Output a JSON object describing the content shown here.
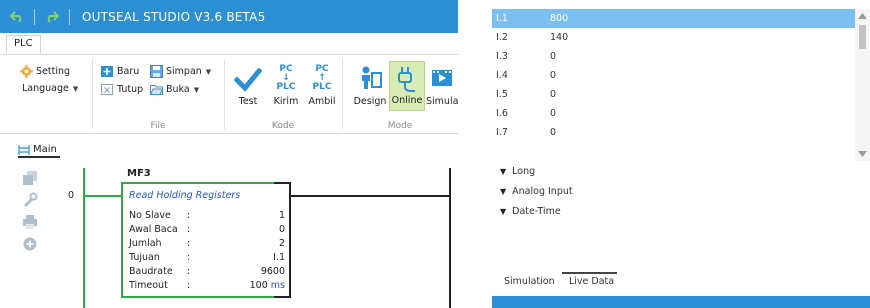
{
  "window": {
    "title": "OUTSEAL STUDIO V3.6 BETA5",
    "undo_icon": "undo-icon",
    "redo_icon": "redo-icon"
  },
  "ribbon": {
    "tab": "PLC",
    "setting_label": "Setting",
    "language_label": "Language",
    "baru_label": "Baru",
    "tutup_label": "Tutup",
    "simpan_label": "Simpan",
    "buka_label": "Buka",
    "file_group_label": "File",
    "test_label": "Test",
    "kirim_label": "Kirim",
    "ambil_label": "Ambil",
    "pc_text": "PC",
    "plc_text": "PLC",
    "kode_group_label": "Kode",
    "design_label": "Design",
    "online_label": "Online",
    "simulation_label": "Simula",
    "mode_group_label": "Mode",
    "colors": {
      "accent": "#2c8fd4",
      "active": "#d8ecb5",
      "check": "#2c8fd4"
    }
  },
  "doc_tab": {
    "label": "Main"
  },
  "ladder": {
    "rung_number": "0",
    "block_title": "MF3",
    "block_name": "Read Holding Registers",
    "params": [
      {
        "key": "No Slave",
        "sep": ":",
        "value": "1",
        "unit": ""
      },
      {
        "key": "Awal Baca",
        "sep": ":",
        "value": "0",
        "unit": ""
      },
      {
        "key": "Jumlah",
        "sep": ":",
        "value": "2",
        "unit": ""
      },
      {
        "key": "Tujuan",
        "sep": ":",
        "value": "I.1",
        "unit": ""
      },
      {
        "key": "Baudrate",
        "sep": ":",
        "value": "9600",
        "unit": ""
      },
      {
        "key": "Timeout",
        "sep": ":",
        "value": "100",
        "unit": "ms"
      }
    ]
  },
  "live_data": {
    "rows": [
      {
        "name": "I.1",
        "value": "800"
      },
      {
        "name": "I.2",
        "value": "140"
      },
      {
        "name": "I.3",
        "value": "0"
      },
      {
        "name": "I.4",
        "value": "0"
      },
      {
        "name": "I.5",
        "value": "0"
      },
      {
        "name": "I.6",
        "value": "0"
      },
      {
        "name": "I.7",
        "value": "0"
      }
    ],
    "categories": [
      "Long",
      "Analog Input",
      "Date-Time"
    ],
    "tabs": {
      "simulation": "Simulation",
      "live_data": "Live Data"
    },
    "colors": {
      "selected_row": "#7cc0f1",
      "status_strip": "#2c8fd4"
    }
  }
}
